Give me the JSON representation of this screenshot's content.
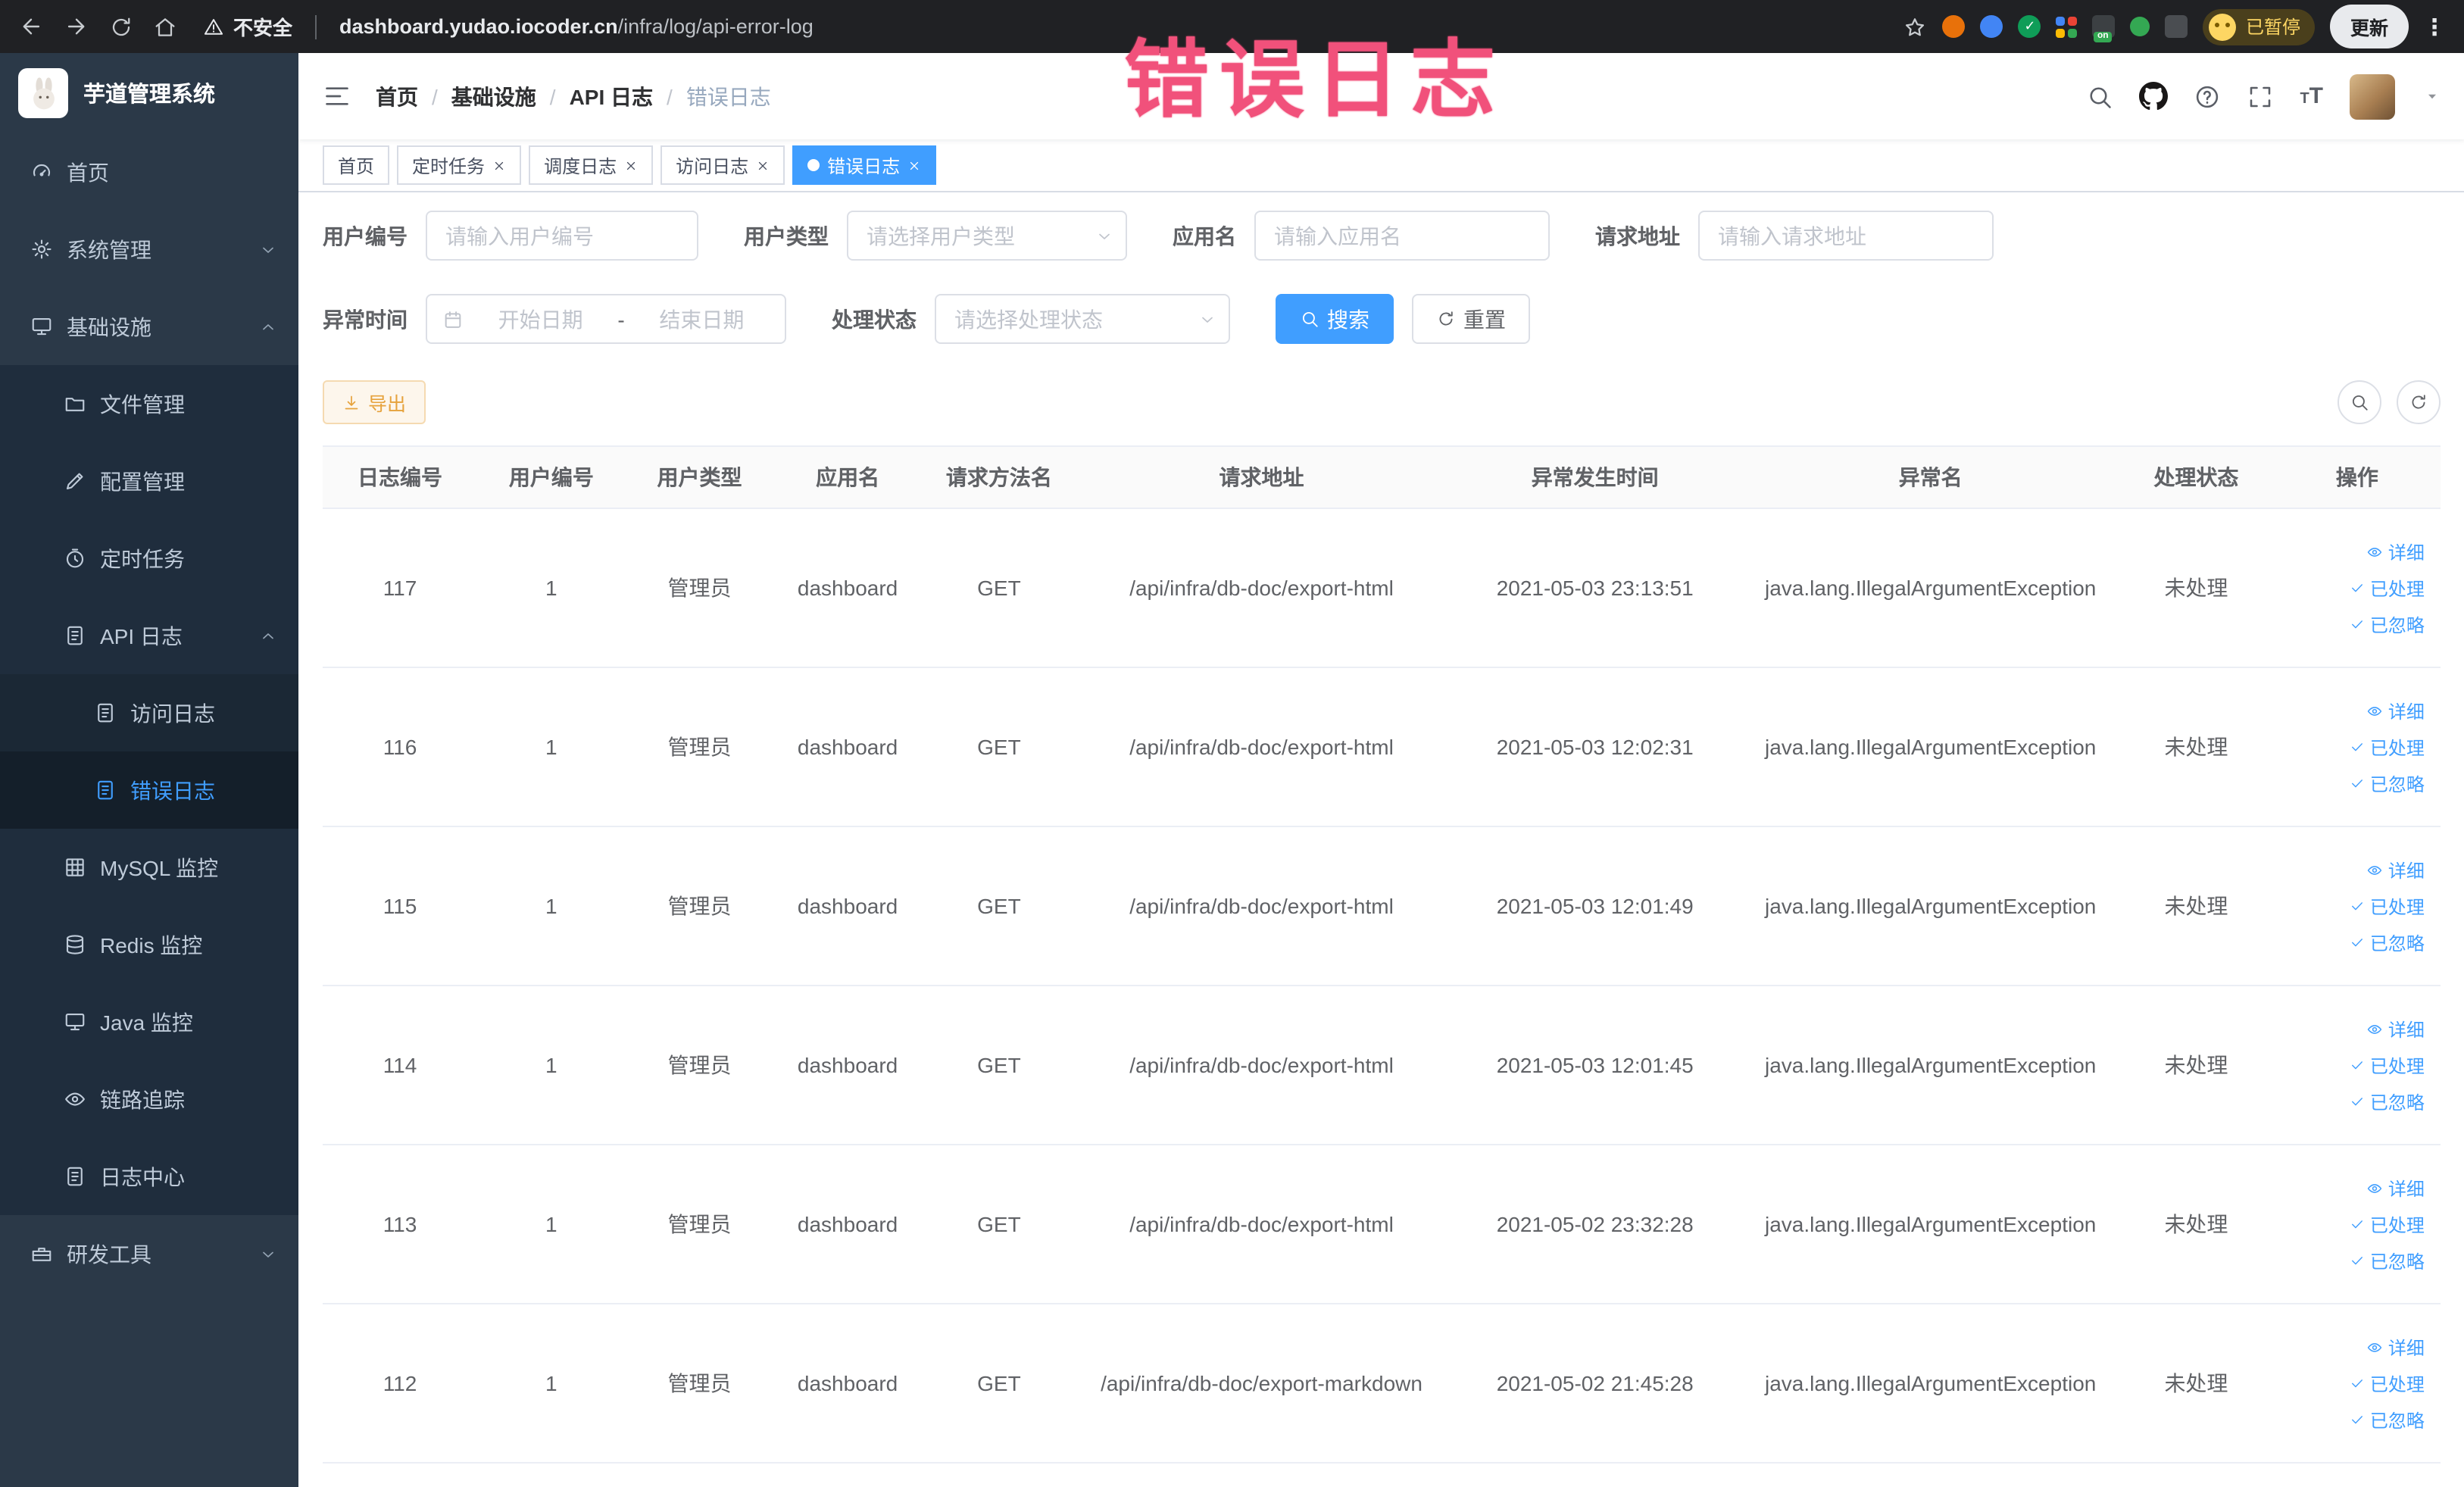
{
  "colors": {
    "accent": "#409eff",
    "warning": "#e6a23c",
    "annotation_pink": "#f1517b",
    "sidebar_bg": "#2b3948",
    "sidebar_sub_bg": "#1f2d3d",
    "browser_bar_bg": "#202124"
  },
  "annotation": {
    "text": "错误日志"
  },
  "browser": {
    "security_label": "不安全",
    "url_domain": "dashboard.yudao.iocoder.cn",
    "url_path": "/infra/log/api-error-log",
    "extension_on_badge": "on",
    "paused_badge": "已暂停",
    "update_button": "更新"
  },
  "sidebar": {
    "logo_title": "芋道管理系统",
    "items": [
      {
        "key": "home",
        "label": "首页",
        "icon": "dashboard",
        "depth": 0
      },
      {
        "key": "system-management",
        "label": "系统管理",
        "icon": "gear",
        "depth": 0,
        "arrow": "down"
      },
      {
        "key": "infrastructure",
        "label": "基础设施",
        "icon": "monitor",
        "depth": 0,
        "arrow": "up"
      },
      {
        "key": "file-management",
        "label": "文件管理",
        "icon": "folder",
        "depth": 1
      },
      {
        "key": "config-management",
        "label": "配置管理",
        "icon": "edit",
        "depth": 1
      },
      {
        "key": "scheduled-task",
        "label": "定时任务",
        "icon": "timer",
        "depth": 1
      },
      {
        "key": "api-log",
        "label": "API 日志",
        "icon": "document",
        "depth": 1,
        "arrow": "up"
      },
      {
        "key": "access-log",
        "label": "访问日志",
        "icon": "document",
        "depth": 2
      },
      {
        "key": "error-log",
        "label": "错误日志",
        "icon": "document",
        "depth": 2,
        "active": true
      },
      {
        "key": "mysql-monitor",
        "label": "MySQL 监控",
        "icon": "grid",
        "depth": 1
      },
      {
        "key": "redis-monitor",
        "label": "Redis 监控",
        "icon": "database",
        "depth": 1
      },
      {
        "key": "java-monitor",
        "label": "Java 监控",
        "icon": "monitor",
        "depth": 1
      },
      {
        "key": "trace",
        "label": "链路追踪",
        "icon": "eye",
        "depth": 1
      },
      {
        "key": "log-center",
        "label": "日志中心",
        "icon": "document",
        "depth": 1
      },
      {
        "key": "dev-tools",
        "label": "研发工具",
        "icon": "toolbox",
        "depth": 0,
        "arrow": "down"
      }
    ]
  },
  "header": {
    "breadcrumb": [
      "首页",
      "基础设施",
      "API 日志",
      "错误日志"
    ]
  },
  "tabs": [
    {
      "label": "首页",
      "closable": false,
      "active": false
    },
    {
      "label": "定时任务",
      "closable": true,
      "active": false
    },
    {
      "label": "调度日志",
      "closable": true,
      "active": false
    },
    {
      "label": "访问日志",
      "closable": true,
      "active": false
    },
    {
      "label": "错误日志",
      "closable": true,
      "active": true
    }
  ],
  "filters": {
    "user_id_label": "用户编号",
    "user_id_placeholder": "请输入用户编号",
    "user_type_label": "用户类型",
    "user_type_placeholder": "请选择用户类型",
    "app_name_label": "应用名",
    "app_name_placeholder": "请输入应用名",
    "request_url_label": "请求地址",
    "request_url_placeholder": "请输入请求地址",
    "exception_time_label": "异常时间",
    "date_start_placeholder": "开始日期",
    "date_separator": "-",
    "date_end_placeholder": "结束日期",
    "process_status_label": "处理状态",
    "process_status_placeholder": "请选择处理状态",
    "search_button": "搜索",
    "reset_button": "重置"
  },
  "toolbar": {
    "export_button": "导出"
  },
  "table": {
    "columns": [
      "日志编号",
      "用户编号",
      "用户类型",
      "应用名",
      "请求方法名",
      "请求地址",
      "异常发生时间",
      "异常名",
      "处理状态",
      "操作"
    ],
    "actions": [
      "详细",
      "已处理",
      "已忽略"
    ],
    "rows": [
      {
        "id": "117",
        "user_id": "1",
        "user_type": "管理员",
        "app_name": "dashboard",
        "method": "GET",
        "url": "/api/infra/db-doc/export-html",
        "time": "2021-05-03 23:13:51",
        "exception": "java.lang.IllegalArgumentException",
        "status": "未处理"
      },
      {
        "id": "116",
        "user_id": "1",
        "user_type": "管理员",
        "app_name": "dashboard",
        "method": "GET",
        "url": "/api/infra/db-doc/export-html",
        "time": "2021-05-03 12:02:31",
        "exception": "java.lang.IllegalArgumentException",
        "status": "未处理"
      },
      {
        "id": "115",
        "user_id": "1",
        "user_type": "管理员",
        "app_name": "dashboard",
        "method": "GET",
        "url": "/api/infra/db-doc/export-html",
        "time": "2021-05-03 12:01:49",
        "exception": "java.lang.IllegalArgumentException",
        "status": "未处理"
      },
      {
        "id": "114",
        "user_id": "1",
        "user_type": "管理员",
        "app_name": "dashboard",
        "method": "GET",
        "url": "/api/infra/db-doc/export-html",
        "time": "2021-05-03 12:01:45",
        "exception": "java.lang.IllegalArgumentException",
        "status": "未处理"
      },
      {
        "id": "113",
        "user_id": "1",
        "user_type": "管理员",
        "app_name": "dashboard",
        "method": "GET",
        "url": "/api/infra/db-doc/export-html",
        "time": "2021-05-02 23:32:28",
        "exception": "java.lang.IllegalArgumentException",
        "status": "未处理"
      },
      {
        "id": "112",
        "user_id": "1",
        "user_type": "管理员",
        "app_name": "dashboard",
        "method": "GET",
        "url": "/api/infra/db-doc/export-markdown",
        "time": "2021-05-02 21:45:28",
        "exception": "java.lang.IllegalArgumentException",
        "status": "未处理"
      }
    ]
  }
}
